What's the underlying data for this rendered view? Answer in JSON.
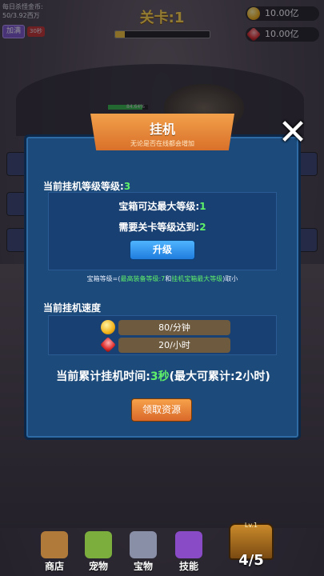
{
  "hud": {
    "daily_label": "每日杀怪金币:",
    "daily_value": "50/3.92西万",
    "add_button": "加满",
    "timer_badge": "30秒",
    "stage_title": "关卡:1",
    "stage_progress": 0.1,
    "gold": "10.00亿",
    "gems": "10.00亿",
    "enemy_hp_text": "84.64%",
    "enemy_hp_fraction": 0.85
  },
  "modal": {
    "title": "挂机",
    "subtitle": "无论是否在线都会增加",
    "current_level_label": "当前挂机等级等级:",
    "current_level_value": "3",
    "max_chest_label": "宝箱可达最大等级:",
    "max_chest_value": "1",
    "required_stage_label": "需要关卡等级达到:",
    "required_stage_value": "2",
    "upgrade_button": "升级",
    "hint_prefix": "宝箱等级=(",
    "hint_a": "最高装备等级:7",
    "hint_mid": "和",
    "hint_b": "挂机宝箱最大等级",
    "hint_suffix": ")取小",
    "speed_label": "当前挂机速度",
    "gold_rate": "80/分钟",
    "gem_rate": "20/小时",
    "accum_label": "当前累计挂机时间:",
    "accum_value": "3秒",
    "accum_max": "(最大可累计:2小时)",
    "claim_button": "领取资源",
    "close_icon": "close-icon"
  },
  "nav": {
    "items": [
      {
        "label": "商店",
        "icon": "shop-icon",
        "color": "#b07a3a"
      },
      {
        "label": "宠物",
        "icon": "pet-icon",
        "color": "#7cae3e"
      },
      {
        "label": "宝物",
        "icon": "treasure-icon",
        "color": "#8a8fa8"
      },
      {
        "label": "技能",
        "icon": "skill-icon",
        "color": "#8a4bc7"
      }
    ],
    "chest_level": "Lv.1",
    "chest_count": "4/5"
  }
}
